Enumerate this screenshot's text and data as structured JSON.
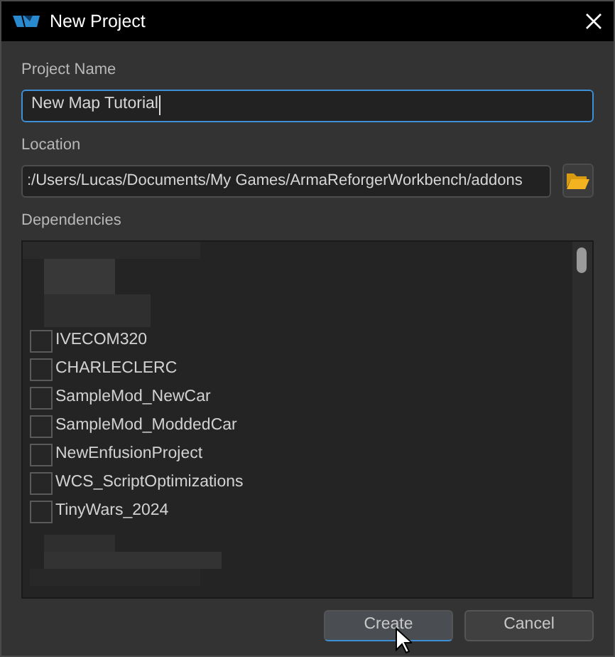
{
  "window": {
    "title": "New Project"
  },
  "project_name": {
    "label": "Project Name",
    "value": "New Map Tutorial",
    "focused": true
  },
  "location": {
    "label": "Location",
    "value": ":/Users/Lucas/Documents/My Games/ArmaReforgerWorkbench/addons"
  },
  "dependencies": {
    "label": "Dependencies",
    "items": [
      {
        "label": "IVECOM320",
        "checked": false
      },
      {
        "label": "CHARLECLERC",
        "checked": false
      },
      {
        "label": "SampleMod_NewCar",
        "checked": false
      },
      {
        "label": "SampleMod_ModdedCar",
        "checked": false
      },
      {
        "label": "NewEnfusionProject",
        "checked": false
      },
      {
        "label": "WCS_ScriptOptimizations",
        "checked": false
      },
      {
        "label": "TinyWars_2024",
        "checked": false
      }
    ]
  },
  "buttons": [
    {
      "label": "Create",
      "default": true
    },
    {
      "label": "Cancel",
      "default": false
    }
  ]
}
